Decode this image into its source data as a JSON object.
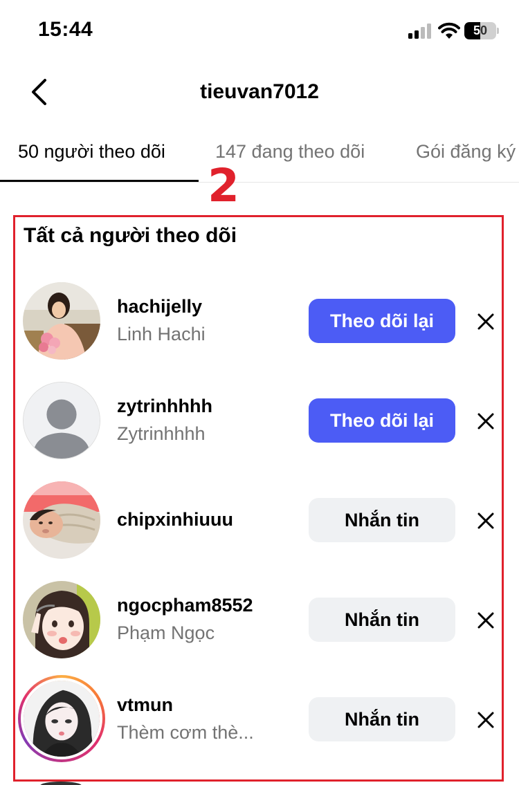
{
  "status_bar": {
    "time": "15:44",
    "battery": "50",
    "battery_level": 0.5
  },
  "header": {
    "title": "tieuvan7012",
    "back_icon": "chevron-left-icon"
  },
  "tabs": [
    {
      "label": "50 người theo dõi",
      "active": true
    },
    {
      "label": "147 đang theo dõi",
      "active": false
    },
    {
      "label": "Gói đăng ký",
      "active": false
    }
  ],
  "annotation": {
    "marker": "2",
    "color": "#e0212c"
  },
  "section": {
    "title": "Tất cả người theo dõi"
  },
  "followers": [
    {
      "username": "hachijelly",
      "full_name": "Linh Hachi",
      "button": "Theo dõi lại",
      "button_style": "primary",
      "remove_icon": "close-icon"
    },
    {
      "username": "zytrinhhhh",
      "full_name": "Zytrinhhhh",
      "button": "Theo dõi lại",
      "button_style": "primary",
      "remove_icon": "close-icon"
    },
    {
      "username": "chipxinhiuuu",
      "full_name": "",
      "button": "Nhắn tin",
      "button_style": "secondary",
      "remove_icon": "close-icon"
    },
    {
      "username": "ngocpham8552",
      "full_name": "Phạm Ngọc",
      "button": "Nhắn tin",
      "button_style": "secondary",
      "remove_icon": "close-icon"
    },
    {
      "username": "vtmun",
      "full_name": "Thèm cơm thè...",
      "button": "Nhắn tin",
      "button_style": "secondary",
      "remove_icon": "close-icon",
      "story_ring": true
    }
  ],
  "colors": {
    "primary_button": "#4c5cf5",
    "secondary_button": "#eff1f3",
    "secondary_text": "#737373"
  }
}
